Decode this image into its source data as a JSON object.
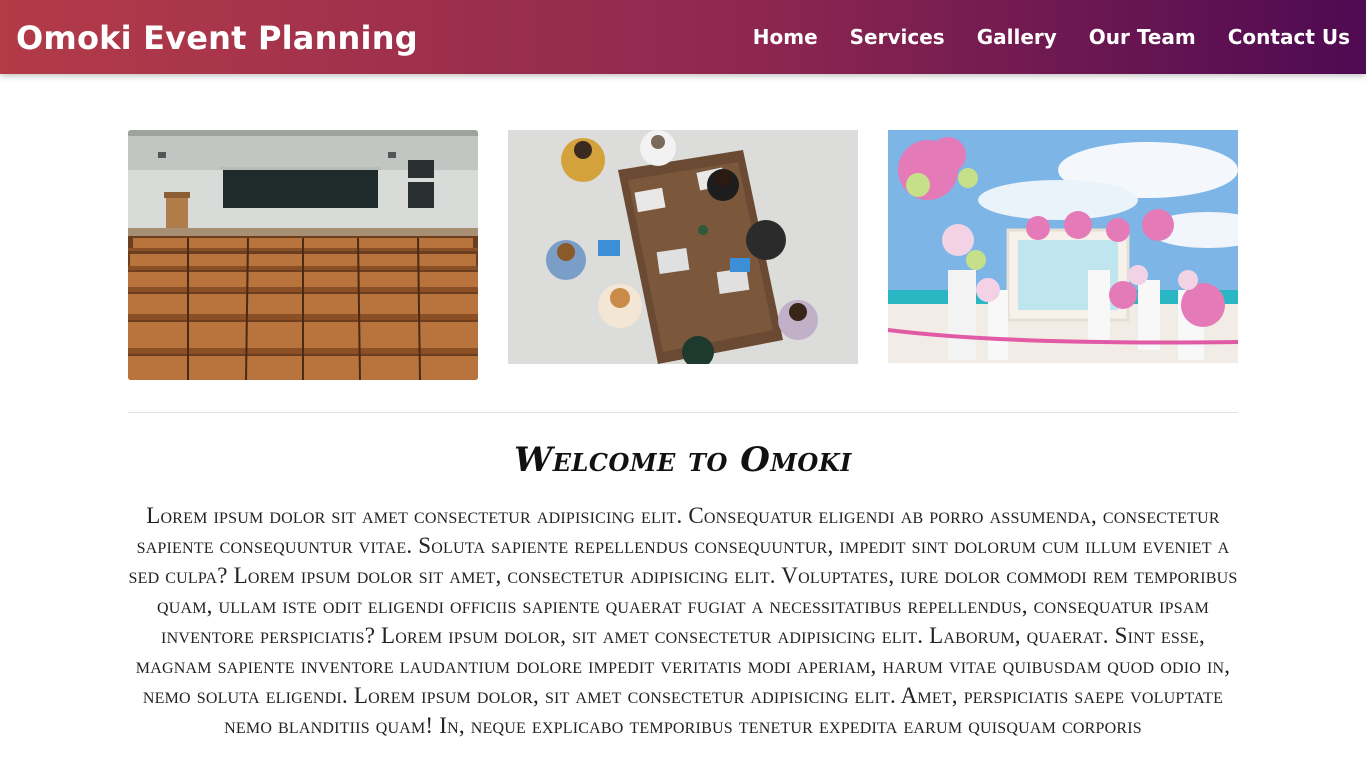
{
  "navbar": {
    "brand": "Omoki Event Planning",
    "links": [
      "Home",
      "Services",
      "Gallery",
      "Our Team",
      "Contact Us"
    ],
    "gradient_start": "#b33b48",
    "gradient_end": "#4e0a52"
  },
  "gallery": {
    "images": [
      {
        "subject": "lecture-hall-seats"
      },
      {
        "subject": "team-meeting-table"
      },
      {
        "subject": "beach-wedding-flowers"
      }
    ]
  },
  "welcome": {
    "title": "Welcome to Omoki",
    "body": "Lorem ipsum dolor sit amet consectetur adipisicing elit. Consequatur eligendi ab porro assumenda, consectetur sapiente consequuntur vitae. Soluta sapiente repellendus consequuntur, impedit sint dolorum cum illum eveniet a sed culpa? Lorem ipsum dolor sit amet, consectetur adipisicing elit. Voluptates, iure dolor commodi rem temporibus quam, ullam iste odit eligendi officiis sapiente quaerat fugiat a necessitatibus repellendus, consequatur ipsam inventore perspiciatis? Lorem ipsum dolor, sit amet consectetur adipisicing elit. Laborum, quaerat. Sint esse, magnam sapiente inventore laudantium dolore impedit veritatis modi aperiam, harum vitae quibusdam quod odio in, nemo soluta eligendi. Lorem ipsum dolor, sit amet consectetur adipisicing elit. Amet, perspiciatis saepe voluptate nemo blanditiis quam! In, neque explicabo temporibus tenetur expedita earum quisquam corporis"
  }
}
